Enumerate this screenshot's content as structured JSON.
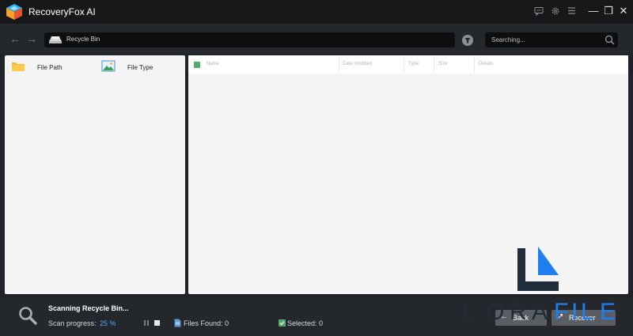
{
  "window": {
    "title": "RecoveryFox AI",
    "toolbar_icons": [
      "feedback-icon",
      "gear-icon",
      "menu-icon"
    ],
    "controls": {
      "minimize": "—",
      "restore": "❐",
      "close": "✕"
    }
  },
  "navbar": {
    "back_glyph": "←",
    "forward_glyph": "→",
    "path": "Recycle Bin",
    "search_placeholder": "Searching..."
  },
  "left_panel": {
    "tabs": [
      {
        "label": "File Path",
        "icon": "folder-icon"
      },
      {
        "label": "File Type",
        "icon": "image-icon"
      }
    ]
  },
  "table": {
    "columns": [
      "Name",
      "Date modified",
      "Type",
      "Size",
      "Details"
    ],
    "check_color": "#55a96b"
  },
  "status": {
    "title": "Scanning Recycle Bin...",
    "progress_label": "Scan progress:",
    "progress_value": "25 %",
    "progress": 0.25,
    "files_found": "Files Found: 0",
    "selected": "Selected: 0"
  },
  "buttons": {
    "back": "Back",
    "recover": "Recover"
  },
  "watermark": {
    "text": "LORAFILE",
    "dark_color": "#1f2d3a",
    "accent_color": "#1e7ff0"
  },
  "colors": {
    "accent": "#4ea3ff",
    "background": "#1f2226"
  }
}
